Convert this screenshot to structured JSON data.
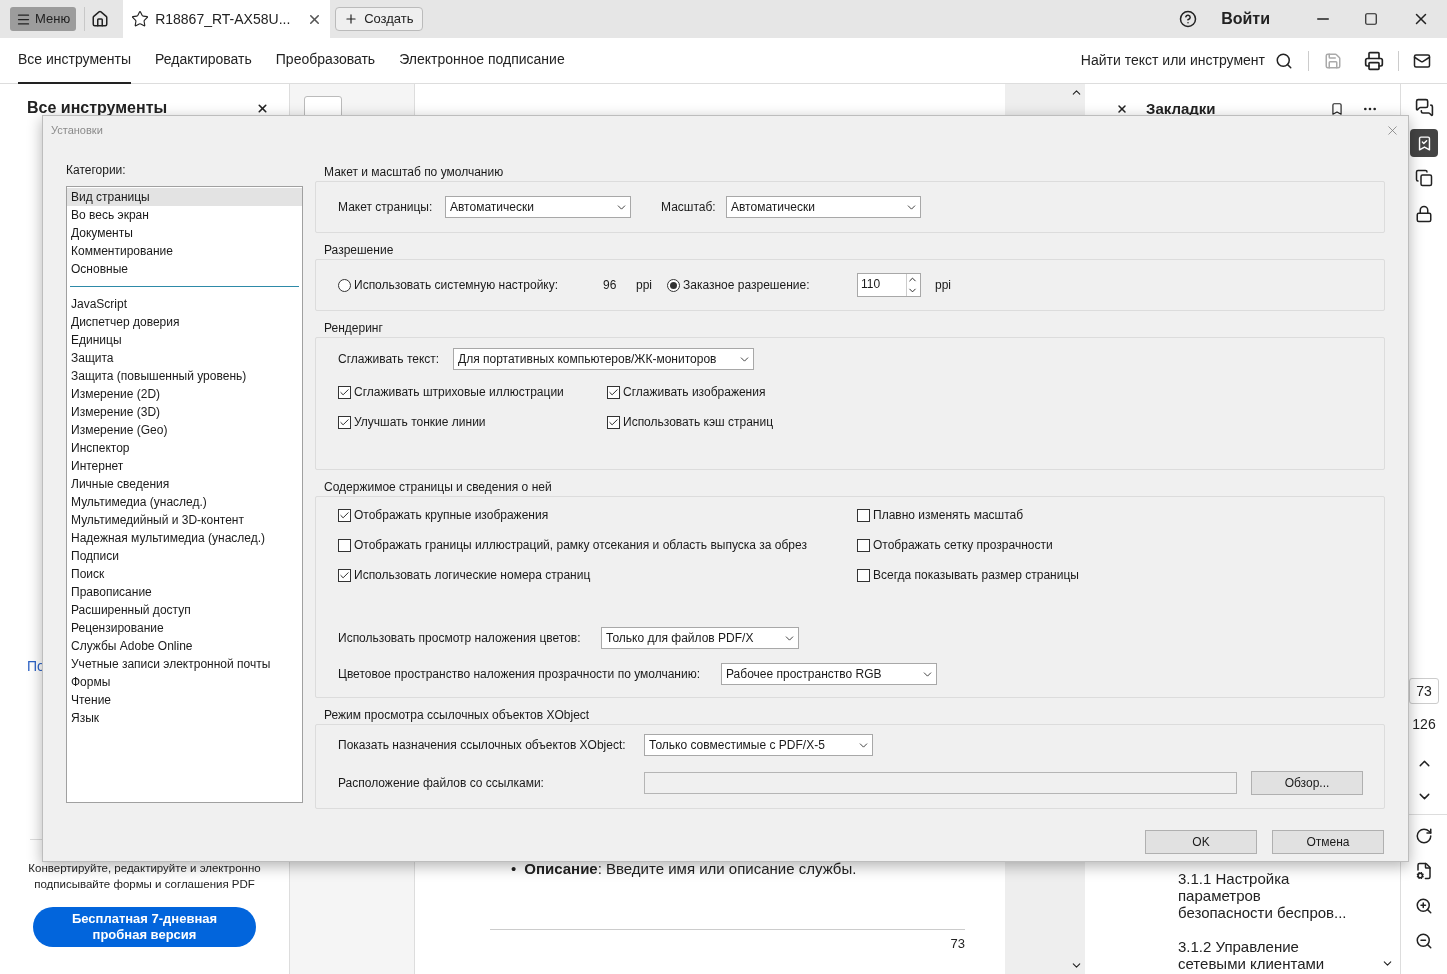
{
  "titlebar": {
    "menu": "Меню",
    "tab_title": "R18867_RT-AX58U...",
    "create": "Создать",
    "sign_in": "Войти"
  },
  "toolbar": {
    "tabs": [
      {
        "label": "Все инструменты",
        "selected": true
      },
      {
        "label": "Редактировать",
        "selected": false
      },
      {
        "label": "Преобразовать",
        "selected": false
      },
      {
        "label": "Электронное подписание",
        "selected": false
      }
    ],
    "search": "Найти текст или инструмент"
  },
  "left_panel": {
    "title": "Все инструменты",
    "link": "По",
    "promo": "Конвертируйте, редактируйте и электронно подписывайте формы и соглашения PDF",
    "trial": "Бесплатная 7-дневная пробная версия"
  },
  "document": {
    "marker": "•",
    "bullet": "**Описание**: Введите имя или описание службы.",
    "page_number": "73"
  },
  "bookmarks": {
    "title": "Закладки",
    "items": [
      "3.1.1 Настройка параметров безопасности беспров...",
      "3.1.2 Управление сетевыми клиентами"
    ]
  },
  "page_nav": {
    "current": "73",
    "total": "126"
  },
  "dialog": {
    "title": "Установки",
    "categories_label": "Категории:",
    "category_groups": [
      {
        "items": [
          {
            "label": "Вид страницы",
            "selected": true
          },
          {
            "label": "Во весь экран",
            "selected": false
          },
          {
            "label": "Документы",
            "selected": false
          },
          {
            "label": "Комментирование",
            "selected": false
          },
          {
            "label": "Основные",
            "selected": false
          }
        ]
      },
      {
        "items": [
          {
            "label": "JavaScript",
            "selected": false
          },
          {
            "label": "Диспетчер доверия",
            "selected": false
          },
          {
            "label": "Единицы",
            "selected": false
          },
          {
            "label": "Защита",
            "selected": false
          },
          {
            "label": "Защита (повышенный уровень)",
            "selected": false
          },
          {
            "label": "Измерение (2D)",
            "selected": false
          },
          {
            "label": "Измерение (3D)",
            "selected": false
          },
          {
            "label": "Измерение (Geo)",
            "selected": false
          },
          {
            "label": "Инспектор",
            "selected": false
          },
          {
            "label": "Интернет",
            "selected": false
          },
          {
            "label": "Личные сведения",
            "selected": false
          },
          {
            "label": "Мультимедиа (унаслед.)",
            "selected": false
          },
          {
            "label": "Мультимедийный и 3D-контент",
            "selected": false
          },
          {
            "label": "Надежная мультимедиа (унаслед.)",
            "selected": false
          },
          {
            "label": "Подписи",
            "selected": false
          },
          {
            "label": "Поиск",
            "selected": false
          },
          {
            "label": "Правописание",
            "selected": false
          },
          {
            "label": "Расширенный доступ",
            "selected": false
          },
          {
            "label": "Рецензирование",
            "selected": false
          },
          {
            "label": "Службы Adobe Online",
            "selected": false
          },
          {
            "label": "Учетные записи электронной почты",
            "selected": false
          },
          {
            "label": "Формы",
            "selected": false
          },
          {
            "label": "Чтение",
            "selected": false
          },
          {
            "label": "Язык",
            "selected": false
          }
        ]
      }
    ],
    "sections": [
      {
        "title": "Макет и масштаб по умолчанию",
        "rows": [
          {
            "items": [
              {
                "kind": "label",
                "text": "Макет страницы:"
              },
              {
                "kind": "select",
                "value": "Автоматически"
              },
              {
                "kind": "label",
                "text": "Масштаб:"
              },
              {
                "kind": "select",
                "value": "Автоматически"
              }
            ]
          }
        ]
      },
      {
        "title": "Разрешение",
        "rows": [
          {
            "items": [
              {
                "kind": "radio",
                "label": "Использовать системную настройку:",
                "selected": false
              },
              {
                "kind": "label",
                "text": "96"
              },
              {
                "kind": "label",
                "text": "ppi"
              },
              {
                "kind": "radio",
                "label": "Заказное разрешение:",
                "selected": true
              },
              {
                "kind": "spinner",
                "value": "110"
              },
              {
                "kind": "label",
                "text": "ppi"
              }
            ]
          }
        ]
      },
      {
        "title": "Рендеринг",
        "rows": [
          {
            "items": [
              {
                "kind": "label",
                "text": "Сглаживать текст:"
              },
              {
                "kind": "select",
                "value": "Для портативных компьютеров/ЖК-мониторов"
              }
            ]
          },
          {
            "items": [
              {
                "kind": "checkbox",
                "label": "Сглаживать штриховые иллюстрации",
                "checked": true
              },
              {
                "kind": "checkbox",
                "label": "Сглаживать изображения",
                "checked": true
              }
            ]
          },
          {
            "items": [
              {
                "kind": "checkbox",
                "label": "Улучшать тонкие линии",
                "checked": true
              },
              {
                "kind": "checkbox",
                "label": "Использовать кэш страниц",
                "checked": true
              }
            ]
          }
        ]
      },
      {
        "title": "Содержимое страницы и сведения о ней",
        "rows": [
          {
            "items": [
              {
                "kind": "checkbox",
                "label": "Отображать крупные изображения",
                "checked": true
              },
              {
                "kind": "checkbox",
                "label": "Плавно изменять масштаб",
                "checked": false
              }
            ]
          },
          {
            "items": [
              {
                "kind": "checkbox",
                "label": "Отображать границы иллюстраций, рамку отсекания и область выпуска за обрез",
                "checked": false
              },
              {
                "kind": "checkbox",
                "label": "Отображать сетку прозрачности",
                "checked": false
              }
            ]
          },
          {
            "items": [
              {
                "kind": "checkbox",
                "label": "Использовать логические номера страниц",
                "checked": true
              },
              {
                "kind": "checkbox",
                "label": "Всегда показывать размер страницы",
                "checked": false
              }
            ]
          },
          {
            "items": [
              {
                "kind": "label",
                "text": "Использовать просмотр наложения цветов:"
              },
              {
                "kind": "select",
                "value": "Только для файлов PDF/X"
              }
            ]
          },
          {
            "items": [
              {
                "kind": "label",
                "text": "Цветовое пространство наложения прозрачности по умолчанию:"
              },
              {
                "kind": "select",
                "value": "Рабочее пространство RGB"
              }
            ]
          }
        ]
      },
      {
        "title": "Режим просмотра ссылочных объектов XObject",
        "rows": [
          {
            "items": [
              {
                "kind": "label",
                "text": "Показать назначения ссылочных объектов XObject:"
              },
              {
                "kind": "select",
                "value": "Только совместимые с PDF/X-5"
              }
            ]
          },
          {
            "items": [
              {
                "kind": "label",
                "text": "Расположение файлов со ссылками:"
              },
              {
                "kind": "path"
              },
              {
                "kind": "button",
                "label": "Обзор..."
              }
            ]
          }
        ]
      }
    ],
    "buttons": [
      "OK",
      "Отмена"
    ]
  }
}
